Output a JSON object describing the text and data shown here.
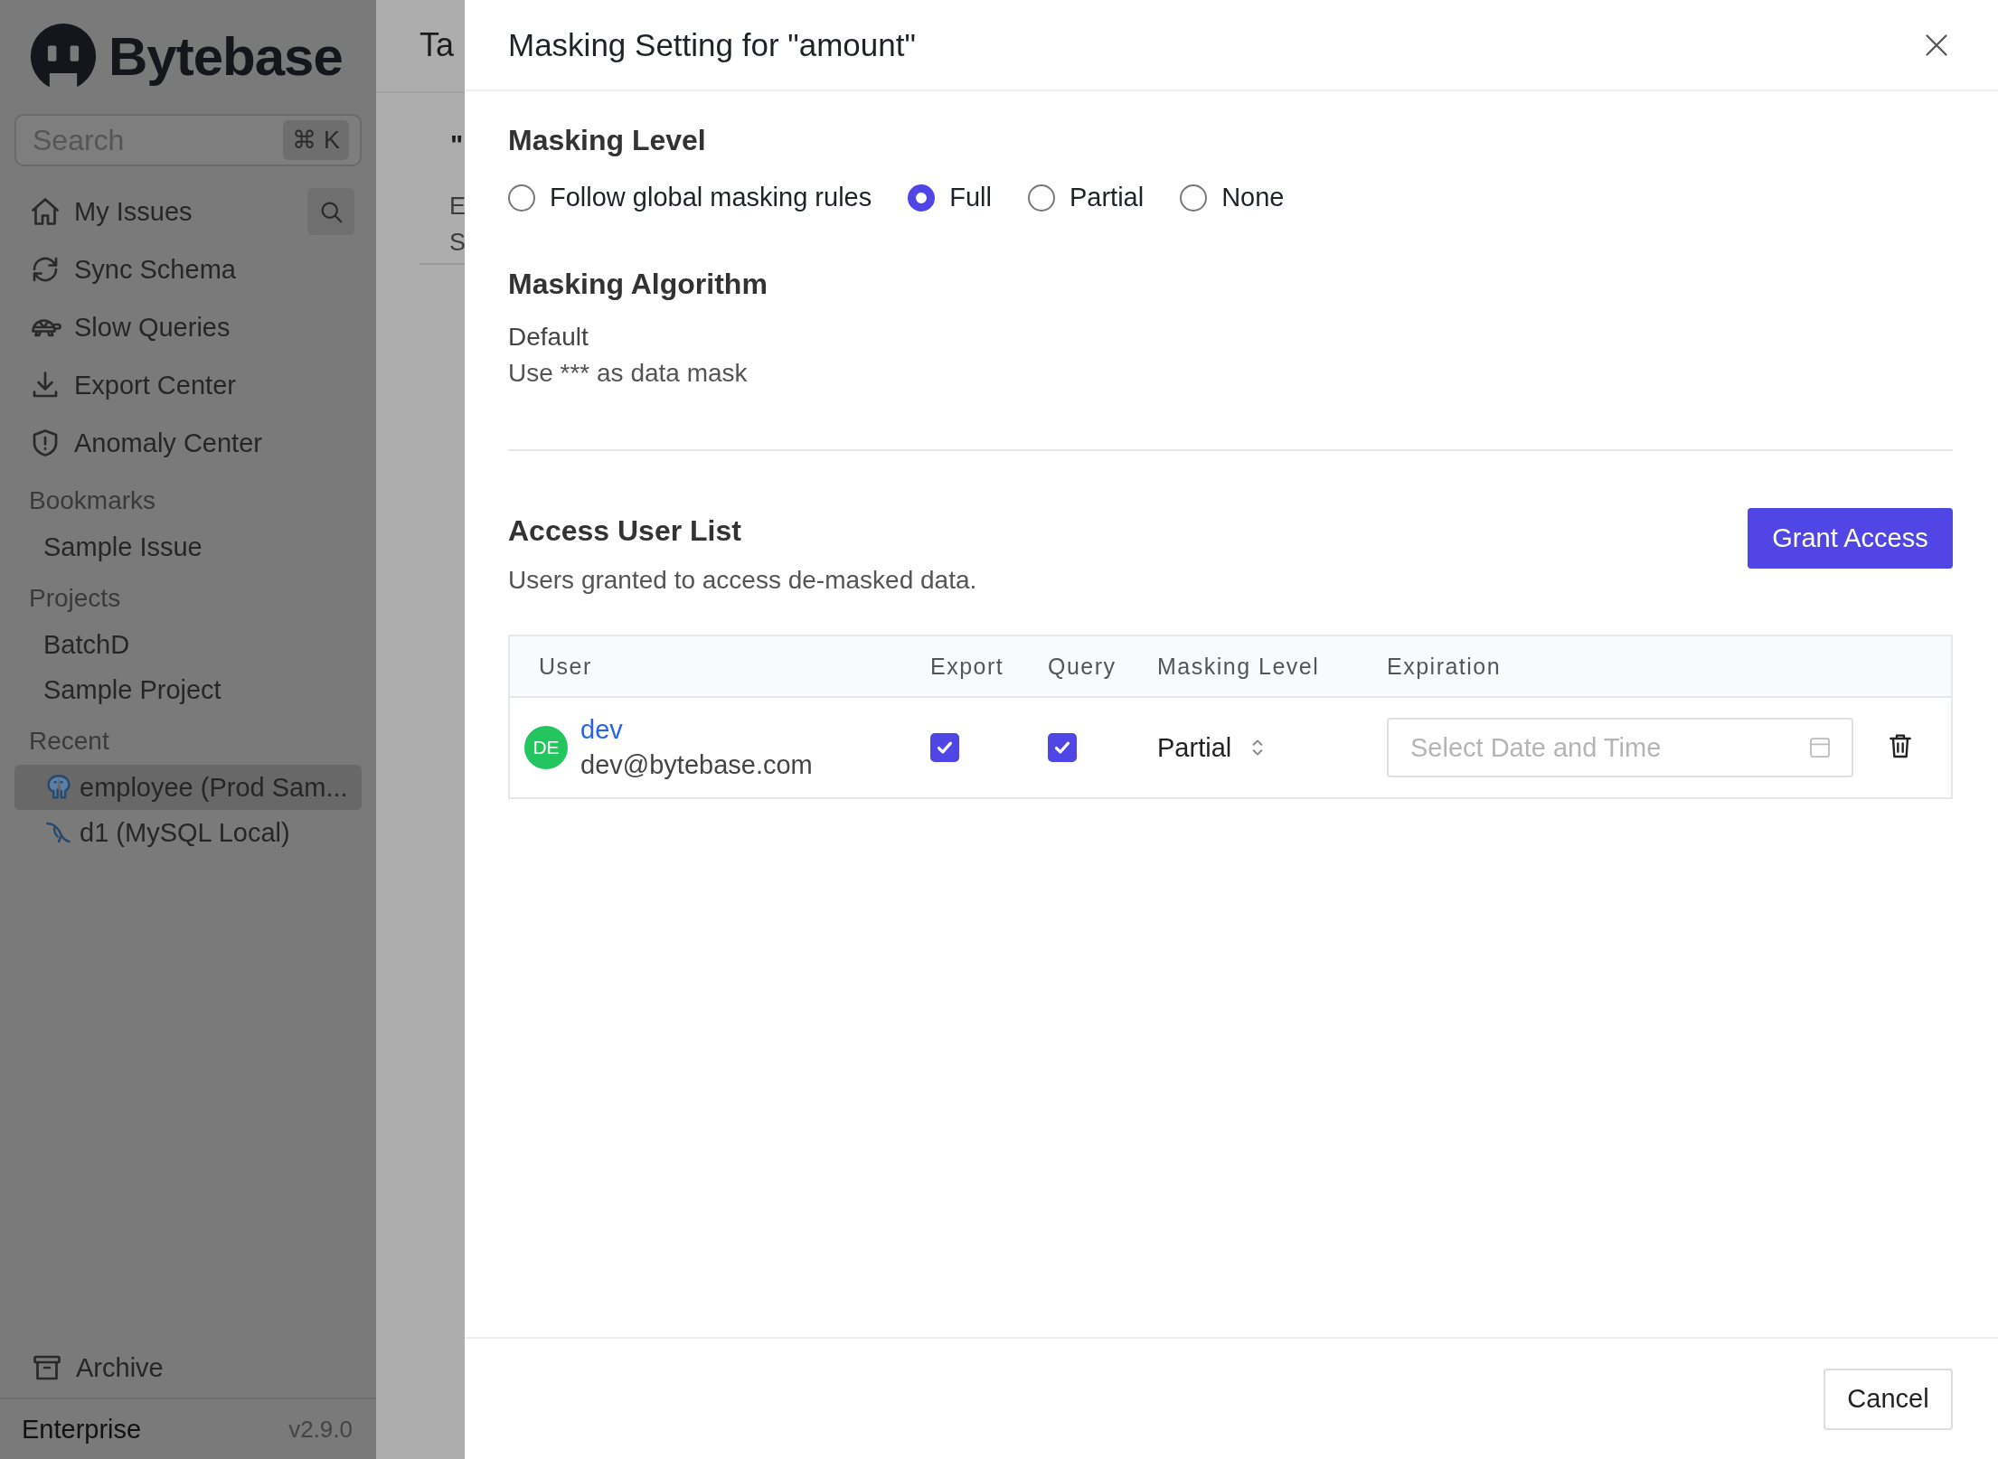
{
  "sidebar": {
    "logo": "Bytebase",
    "search": {
      "placeholder": "Search",
      "shortcut": "⌘ K"
    },
    "nav_items": [
      {
        "label": "My Issues"
      },
      {
        "label": "Sync Schema"
      },
      {
        "label": "Slow Queries"
      },
      {
        "label": "Export Center"
      },
      {
        "label": "Anomaly Center"
      }
    ],
    "sections": [
      {
        "title": "Bookmarks",
        "items": [
          {
            "label": "Sample Issue",
            "selected": false
          }
        ]
      },
      {
        "title": "Projects",
        "items": [
          {
            "label": "BatchD",
            "selected": false
          },
          {
            "label": "Sample Project",
            "selected": false
          }
        ]
      },
      {
        "title": "Recent",
        "items": [
          {
            "label": "employee (Prod Sam...",
            "selected": true
          },
          {
            "label": "d1 (MySQL Local)",
            "selected": false
          }
        ]
      }
    ],
    "archive": "Archive",
    "plan": "Enterprise",
    "version": "v2.9.0"
  },
  "background_page": {
    "title": "Ta",
    "lines": [
      "\"",
      "E",
      "S"
    ]
  },
  "dialog": {
    "title": "Masking Setting for \"amount\"",
    "masking_level": {
      "heading": "Masking Level",
      "options": [
        {
          "label": "Follow global masking rules",
          "selected": false
        },
        {
          "label": "Full",
          "selected": true
        },
        {
          "label": "Partial",
          "selected": false
        },
        {
          "label": "None",
          "selected": false
        }
      ]
    },
    "algorithm": {
      "heading": "Masking Algorithm",
      "name": "Default",
      "description": "Use *** as data mask"
    },
    "access": {
      "heading": "Access User List",
      "subtitle": "Users granted to access de-masked data.",
      "grant_button": "Grant Access",
      "table": {
        "columns": [
          "User",
          "Export",
          "Query",
          "Masking Level",
          "Expiration"
        ],
        "rows": [
          {
            "avatar": "DE",
            "name": "dev",
            "email": "dev@bytebase.com",
            "export": true,
            "query": true,
            "masking_level": "Partial",
            "expiration": {
              "placeholder": "Select Date and Time"
            }
          }
        ]
      }
    },
    "footer": {
      "cancel": "Cancel"
    }
  }
}
